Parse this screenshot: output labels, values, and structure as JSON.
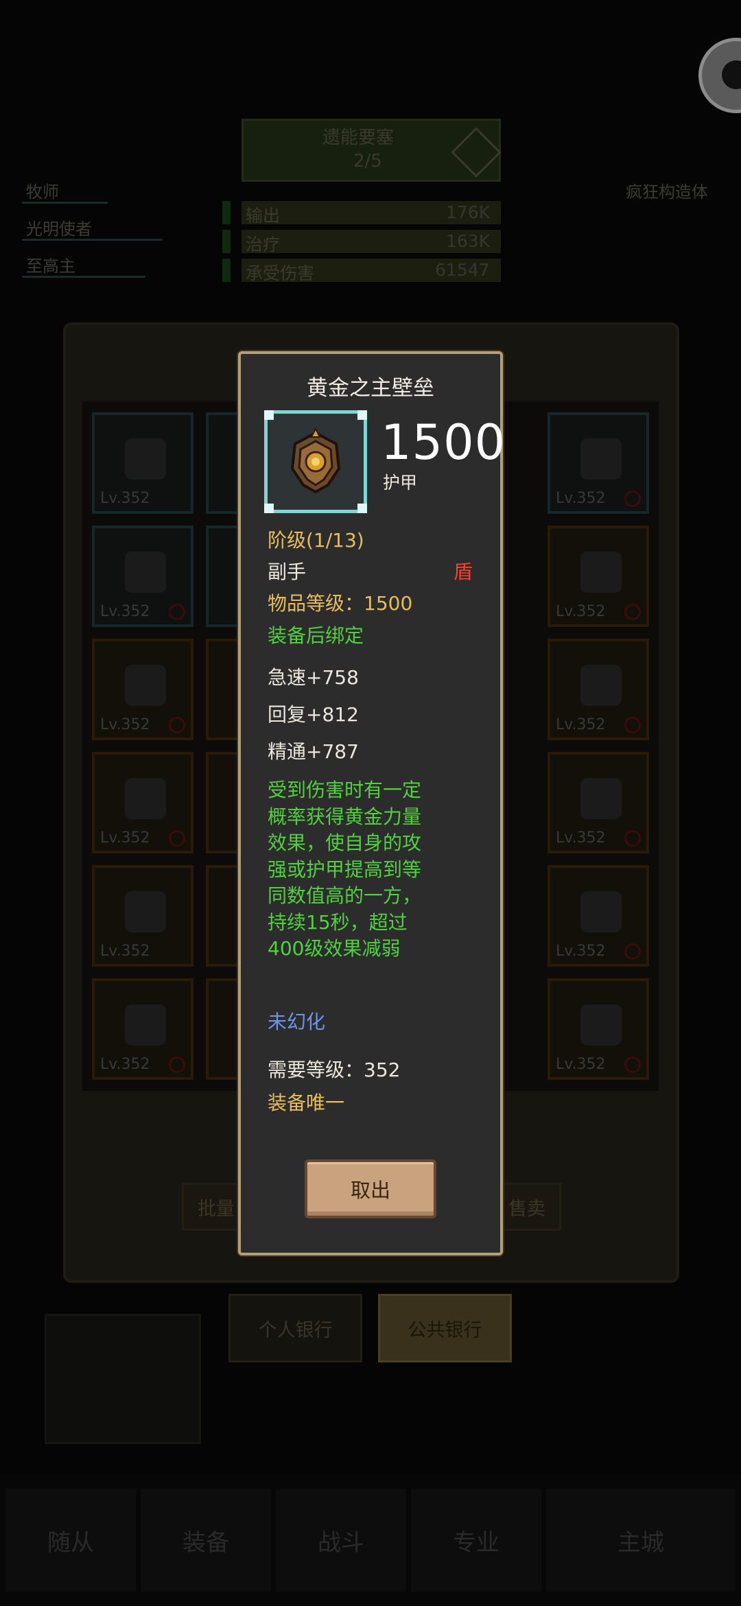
{
  "background": {
    "dungeon": {
      "title": "遗能要塞",
      "progress": "2/5"
    },
    "roles": [
      "牧师",
      "光明使者",
      "至高主"
    ],
    "right_role": "疯狂构造体",
    "stats": [
      {
        "label": "输出",
        "value": "176K"
      },
      {
        "label": "治疗",
        "value": "163K"
      },
      {
        "label": "承受伤害",
        "value": "61547"
      }
    ],
    "bag_buttons": {
      "left": "批量",
      "right": "售卖"
    },
    "bank_tabs": {
      "personal": "个人银行",
      "public": "公共银行"
    },
    "nav": [
      "随从",
      "装备",
      "战斗",
      "专业",
      "主城"
    ],
    "slot_level": "Lv.352"
  },
  "item": {
    "name": "黄金之主壁垒",
    "icon": "golden-shield-icon",
    "armor_value": "1500",
    "armor_label": "护甲",
    "tier": "阶级(1/13)",
    "slot": "副手",
    "type": "盾",
    "item_level": "物品等级：1500",
    "bind": "装备后绑定",
    "stats": [
      "急速+758",
      "回复+812",
      "精通+787"
    ],
    "effect_lines": [
      "受到伤害时有一定",
      "概率获得黄金力量",
      "效果，使自身的攻",
      "强或护甲提高到等",
      "同数值高的一方，",
      "持续15秒，超过",
      "400级效果减弱"
    ],
    "transmog": "未幻化",
    "required_level": "需要等级：352",
    "unique": "装备唯一",
    "take_button": "取出"
  },
  "colors": {
    "quality_gold": "#e9be5a",
    "effect_green": "#50d23e",
    "transmog_blue": "#6d96e4",
    "shield_red": "#ff3e2e",
    "icon_border": "#7fd4d4",
    "dialog_border": "#b59e7a"
  }
}
